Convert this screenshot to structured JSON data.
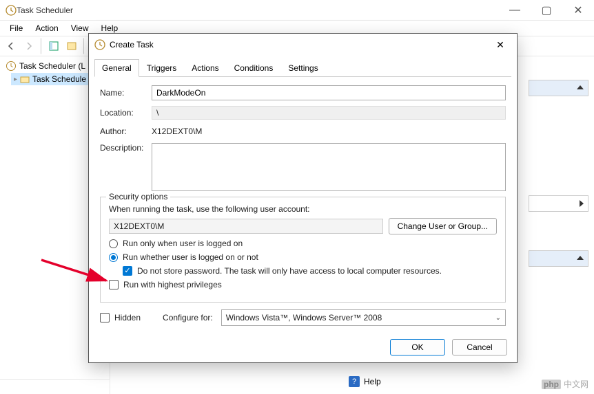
{
  "window": {
    "title": "Task Scheduler",
    "menus": [
      "File",
      "Action",
      "View",
      "Help"
    ]
  },
  "tree": {
    "root": "Task Scheduler (L",
    "child": "Task Schedule"
  },
  "dialog": {
    "title": "Create Task",
    "tabs": [
      "General",
      "Triggers",
      "Actions",
      "Conditions",
      "Settings"
    ],
    "fields": {
      "name_label": "Name:",
      "name_value": "DarkModeOn",
      "location_label": "Location:",
      "location_value": "\\",
      "author_label": "Author:",
      "author_value": "X12DEXT0\\M",
      "description_label": "Description:"
    },
    "security": {
      "legend": "Security options",
      "prompt": "When running the task, use the following user account:",
      "account": "X12DEXT0\\M",
      "change_btn": "Change User or Group...",
      "radio_logged_on": "Run only when user is logged on",
      "radio_whether": "Run whether user is logged on or not",
      "check_nostore": "Do not store password.  The task will only have access to local computer resources.",
      "check_highest": "Run with highest privileges"
    },
    "bottom": {
      "hidden_label": "Hidden",
      "configure_label": "Configure for:",
      "configure_value": "Windows Vista™, Windows Server™ 2008"
    },
    "buttons": {
      "ok": "OK",
      "cancel": "Cancel"
    }
  },
  "help": {
    "label": "Help"
  },
  "watermark": {
    "text": "中文网",
    "prefix": "php"
  }
}
